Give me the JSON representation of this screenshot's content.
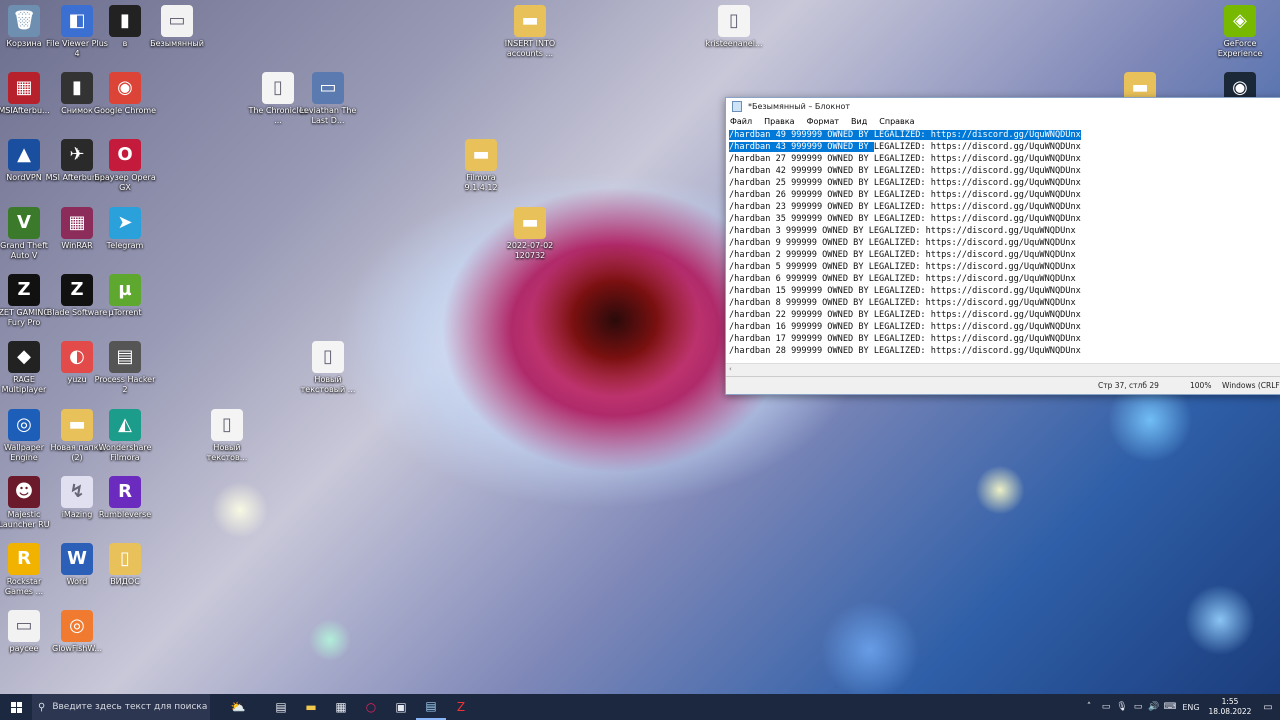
{
  "desktop_icons": [
    {
      "name": "Корзина",
      "glyph": "🗑",
      "bg": "#6f8fb0"
    },
    {
      "name": "File Viewer Plus 4",
      "glyph": "◧",
      "bg": "#3b6fd1"
    },
    {
      "name": "в",
      "glyph": "▮",
      "bg": "#222"
    },
    {
      "name": "Безымянный",
      "glyph": "▭",
      "bg": "#f2f2f2"
    },
    {
      "name": "MSIAfterbu...",
      "glyph": "▦",
      "bg": "#b6212b"
    },
    {
      "name": "Снимок",
      "glyph": "▮",
      "bg": "#333"
    },
    {
      "name": "Google Chrome",
      "glyph": "◉",
      "bg": "#db4437"
    },
    {
      "name": "NordVPN",
      "glyph": "▲",
      "bg": "#1a4fa0"
    },
    {
      "name": "MSI Afterburner",
      "glyph": "✈",
      "bg": "#2a2a2a"
    },
    {
      "name": "Браузер Opera GX",
      "glyph": "O",
      "bg": "#c41a3b"
    },
    {
      "name": "Grand Theft Auto V",
      "glyph": "V",
      "bg": "#3a7a2a"
    },
    {
      "name": "WinRAR",
      "glyph": "▦",
      "bg": "#8b2c5a"
    },
    {
      "name": "Telegram",
      "glyph": "➤",
      "bg": "#2aa1da"
    },
    {
      "name": "ZET GAMING Fury Pro",
      "glyph": "Z",
      "bg": "#111"
    },
    {
      "name": "Blade Software",
      "glyph": "Z",
      "bg": "#111"
    },
    {
      "name": "µTorrent",
      "glyph": "µ",
      "bg": "#5fa830"
    },
    {
      "name": "RAGE Multiplayer",
      "glyph": "◆",
      "bg": "#222"
    },
    {
      "name": "yuzu",
      "glyph": "◐",
      "bg": "#e34b4b"
    },
    {
      "name": "Process Hacker 2",
      "glyph": "▤",
      "bg": "#555"
    },
    {
      "name": "Wallpaper Engine",
      "glyph": "◎",
      "bg": "#1d5fb8"
    },
    {
      "name": "Новая папка (2)",
      "glyph": "▬",
      "bg": "#e8c15a"
    },
    {
      "name": "Wondershare Filmora",
      "glyph": "◭",
      "bg": "#1c9c8a"
    },
    {
      "name": "Majestic Launcher RU",
      "glyph": "☻",
      "bg": "#6a1a2a"
    },
    {
      "name": "iMazing",
      "glyph": "↯",
      "bg": "#e0e0f0"
    },
    {
      "name": "Rumbleverse",
      "glyph": "R",
      "bg": "#6b2bbf"
    },
    {
      "name": "Rockstar Games ...",
      "glyph": "R",
      "bg": "#f2b200"
    },
    {
      "name": "Word",
      "glyph": "W",
      "bg": "#2b5fb8"
    },
    {
      "name": "ВИДОС",
      "glyph": "▯",
      "bg": "#e8c15a"
    },
    {
      "name": "paycee",
      "glyph": "▭",
      "bg": "#f2f2f2"
    },
    {
      "name": "GlowFishW...",
      "glyph": "◎",
      "bg": "#f07a30"
    },
    {
      "name": "The Chronicles ...",
      "glyph": "▯",
      "bg": "#f4f4f4"
    },
    {
      "name": "Leviathan The Last D...",
      "glyph": "▭",
      "bg": "#5a7ab0"
    },
    {
      "name": "INSERT INTO accounts ...",
      "glyph": "▬",
      "bg": "#e8c15a"
    },
    {
      "name": "Filmora 9.1.4.12",
      "glyph": "▬",
      "bg": "#e8c15a"
    },
    {
      "name": "2022-07-02 120732",
      "glyph": "▬",
      "bg": "#e8c15a"
    },
    {
      "name": "kristeenanel...",
      "glyph": "▯",
      "bg": "#f4f4f4"
    },
    {
      "name": "Новый текстовый ...",
      "glyph": "▯",
      "bg": "#f4f4f4"
    },
    {
      "name": "Новый текстов...",
      "glyph": "▯",
      "bg": "#f4f4f4"
    },
    {
      "name": "GeForce Experience",
      "glyph": "◈",
      "bg": "#76b900"
    },
    {
      "name": "",
      "glyph": "▬",
      "bg": "#e8c15a"
    },
    {
      "name": "",
      "glyph": "◉",
      "bg": "#1b2838"
    }
  ],
  "notepad": {
    "title": "*Безымянный – Блокнот",
    "menu": [
      "Файл",
      "Правка",
      "Формат",
      "Вид",
      "Справка"
    ],
    "lines": [
      "/hardban 49 999999 OWNED BY LEGALIZED: https://discord.gg/UquWNQDUnx",
      "/hardban 43 999999 OWNED BY LEGALIZED: https://discord.gg/UquWNQDUnx",
      "/hardban 27 999999 OWNED BY LEGALIZED: https://discord.gg/UquWNQDUnx",
      "/hardban 42 999999 OWNED BY LEGALIZED: https://discord.gg/UquWNQDUnx",
      "/hardban 25 999999 OWNED BY LEGALIZED: https://discord.gg/UquWNQDUnx",
      "/hardban 26 999999 OWNED BY LEGALIZED: https://discord.gg/UquWNQDUnx",
      "/hardban 23 999999 OWNED BY LEGALIZED: https://discord.gg/UquWNQDUnx",
      "/hardban 35 999999 OWNED BY LEGALIZED: https://discord.gg/UquWNQDUnx",
      "/hardban 3 999999 OWNED BY LEGALIZED: https://discord.gg/UquWNQDUnx",
      "/hardban 9 999999 OWNED BY LEGALIZED: https://discord.gg/UquWNQDUnx",
      "/hardban 2 999999 OWNED BY LEGALIZED: https://discord.gg/UquWNQDUnx",
      "/hardban 5 999999 OWNED BY LEGALIZED: https://discord.gg/UquWNQDUnx",
      "/hardban 6 999999 OWNED BY LEGALIZED: https://discord.gg/UquWNQDUnx",
      "/hardban 15 999999 OWNED BY LEGALIZED: https://discord.gg/UquWNQDUnx",
      "/hardban 8 999999 OWNED BY LEGALIZED: https://discord.gg/UquWNQDUnx",
      "/hardban 22 999999 OWNED BY LEGALIZED: https://discord.gg/UquWNQDUnx",
      "/hardban 16 999999 OWNED BY LEGALIZED: https://discord.gg/UquWNQDUnx",
      "/hardban 17 999999 OWNED BY LEGALIZED: https://discord.gg/UquWNQDUnx",
      "/hardban 28 999999 OWNED BY LEGALIZED: https://discord.gg/UquWNQDUnx"
    ],
    "status_pos": "Стр 37, стлб 29",
    "status_zoom": "100%",
    "status_eol": "Windows (CRLF)"
  },
  "taskbar": {
    "search_placeholder": "Введите здесь текст для поиска",
    "lang": "ENG",
    "time": "1:55",
    "date": "18.08.2022"
  },
  "colors": {
    "selection": "#0078d7",
    "taskbar": "#1c2740"
  }
}
